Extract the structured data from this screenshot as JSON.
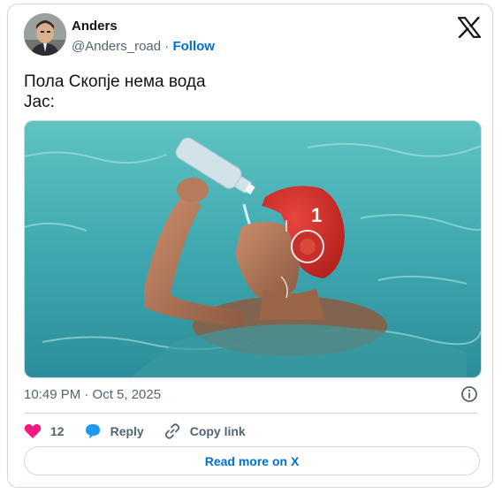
{
  "author": {
    "name": "Anders",
    "handle": "@Anders_road",
    "separator": " · ",
    "follow_label": "Follow"
  },
  "tweet": {
    "line1": "Пола Скопје нема вода",
    "line2": "Јас:"
  },
  "media": {
    "cap_number": "1"
  },
  "timestamp": "10:49 PM · Oct 5, 2025",
  "actions": {
    "like_count": "12",
    "reply_label": "Reply",
    "copy_link_label": "Copy link"
  },
  "read_more_label": "Read more on X",
  "icons": {
    "x_logo": "x-logo-icon",
    "info": "info-icon",
    "like": "heart-icon",
    "reply": "speech-bubble-icon",
    "copy_link": "link-icon"
  },
  "colors": {
    "like": "#f91880",
    "reply": "#1d9bf0",
    "accent": "#006fd6",
    "text": "#0f1419",
    "muted": "#536471",
    "border": "#cfd9de"
  }
}
